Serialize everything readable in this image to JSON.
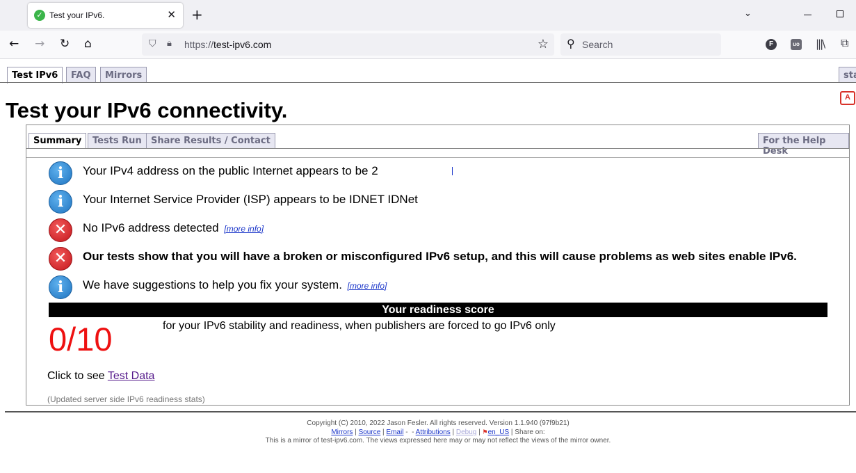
{
  "browser": {
    "tab_title": "Test your IPv6.",
    "tab_close": "✕",
    "new_tab": "+",
    "tab_list": "⌄",
    "url_scheme": "https://",
    "url_host": "test-ipv6.com",
    "search_placeholder": "Search",
    "ext_f": "F",
    "ext_ub": "uo"
  },
  "nav_tabs": [
    {
      "label": "Test IPv6"
    },
    {
      "label": "FAQ"
    },
    {
      "label": "Mirrors"
    },
    {
      "label": "sta"
    }
  ],
  "page": {
    "title": "Test your IPv6 connectivity."
  },
  "sub_tabs": [
    {
      "label": "Summary"
    },
    {
      "label": "Tests Run"
    },
    {
      "label": "Share Results / Contact"
    },
    {
      "label": "For the Help Desk"
    }
  ],
  "results": [
    {
      "status": "info",
      "text": "Your IPv4 address on the public Internet appears to be 2",
      "link": ""
    },
    {
      "status": "info",
      "text": "Your Internet Service Provider (ISP) appears to be IDNET IDNet",
      "link": ""
    },
    {
      "status": "error",
      "text": "No IPv6 address detected",
      "link": "[more info]"
    },
    {
      "status": "error",
      "text": "Our tests show that you will have a broken or misconfigured IPv6 setup, and this will cause problems as web sites enable IPv6.",
      "link": ""
    },
    {
      "status": "info",
      "text": "We have suggestions to help you fix your system.",
      "link": "[more info]"
    }
  ],
  "score": {
    "header": "Your readiness score",
    "value": "0/10",
    "description": "for your IPv6 stability and readiness, when publishers are forced to go IPv6 only"
  },
  "test_data": {
    "prefix": "Click to see ",
    "link": "Test Data"
  },
  "stats_link": "(Updated server side IPv6 readiness stats)",
  "footer": {
    "copyright": "Copyright (C) 2010, 2022 Jason Fesler. All rights reserved. Version 1.1.940 (97f9b21)",
    "mirrors": "Mirrors",
    "source": "Source",
    "email": "Email",
    "attributions": "Attributions",
    "debug": "Debug",
    "locale": "en_US",
    "share_on": "Share on:",
    "mirror_note": "This is a mirror of test-ipv6.com. The views expressed here may or may not reflect the views of the mirror owner."
  },
  "colors": {
    "score": "#ee1111",
    "info_icon": "#1f74c0",
    "error_icon": "#c4161c",
    "link": "#1a35c9"
  }
}
